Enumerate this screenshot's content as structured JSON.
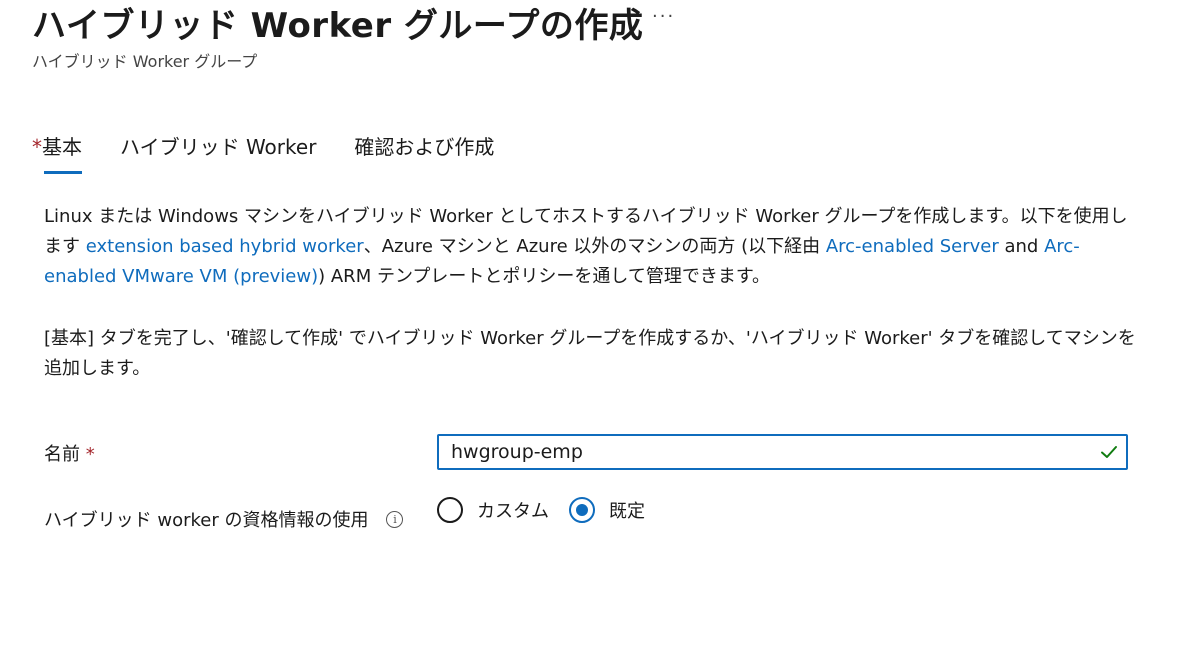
{
  "header": {
    "title": "ハイブリッド Worker グループの作成",
    "more_label": "···",
    "subtitle": "ハイブリッド Worker グループ"
  },
  "tabs": [
    {
      "required_mark": "*",
      "label": "基本",
      "active": true
    },
    {
      "required_mark": "",
      "label": "ハイブリッド Worker",
      "active": false
    },
    {
      "required_mark": "",
      "label": "確認および作成",
      "active": false
    }
  ],
  "description": {
    "p1_text1": "Linux または Windows マシンをハイブリッド Worker としてホストするハイブリッド Worker グループを作成します。以下を使用します ",
    "p1_link1": "extension based hybrid worker",
    "p1_text2": "、Azure マシンと Azure 以外のマシンの両方 (以下経由 ",
    "p1_link2": "Arc-enabled Server",
    "p1_text3": " and ",
    "p1_link3": "Arc-enabled VMware VM (preview)",
    "p1_text4": ") ARM テンプレートとポリシーを通して管理できます。",
    "p2": "[基本] タブを完了し、'確認して作成' でハイブリッド Worker グループを作成するか、'ハイブリッド Worker' タブを確認してマシンを追加します。"
  },
  "form": {
    "name_label": "名前",
    "required_mark": "*",
    "name_value": "hwgroup-emp",
    "credentials_label": "ハイブリッド worker の資格情報の使用",
    "info_glyph": "i",
    "options": [
      {
        "label": "カスタム",
        "checked": false
      },
      {
        "label": "既定",
        "checked": true
      }
    ]
  },
  "colors": {
    "accent": "#0f6cbd",
    "required": "#a4262c",
    "valid": "#107c10"
  }
}
